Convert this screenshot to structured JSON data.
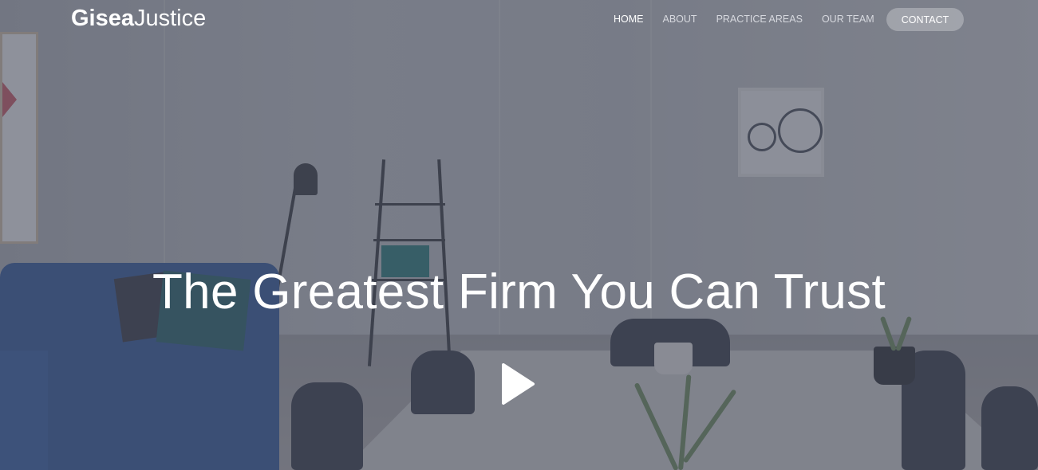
{
  "brand": {
    "bold": "Gisea",
    "light": "Justice"
  },
  "nav": {
    "items": [
      {
        "label": "HOME",
        "active": true
      },
      {
        "label": "ABOUT",
        "active": false
      },
      {
        "label": "PRACTICE AREAS",
        "active": false
      },
      {
        "label": "OUR TEAM",
        "active": false
      }
    ],
    "contact_label": "CONTACT"
  },
  "hero": {
    "headline": "The Greatest Firm You Can Trust",
    "play_icon": "play-icon"
  },
  "colors": {
    "text": "#ffffff",
    "overlay": "#4e5260"
  }
}
